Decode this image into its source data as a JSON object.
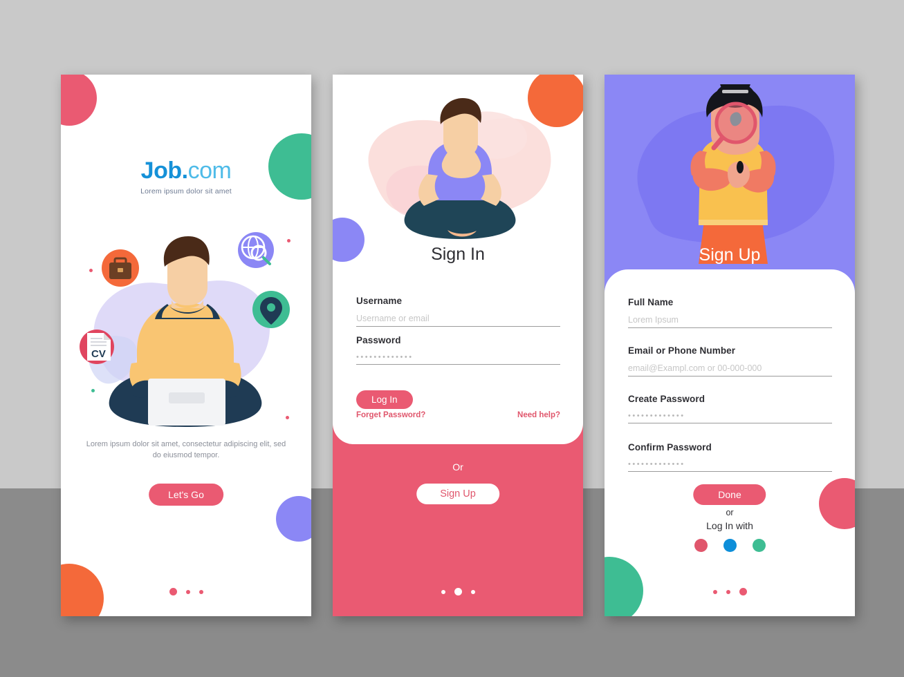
{
  "canvas": {
    "bg_top_color": "#c9c9c9",
    "bg_bottom_color": "#8b8b8b"
  },
  "palette": {
    "pink": "#ea5a72",
    "orange": "#f4693a",
    "green": "#3ebd93",
    "purple": "#8b87f5",
    "blue": "#0d8ed9",
    "logo_blue_dark": "#1591d8",
    "logo_blue_light": "#4ebbe8"
  },
  "screen1": {
    "name": "onboarding-splash",
    "logo": {
      "primary": "Job.",
      "secondary": "com",
      "tagline": "Lorem ipsum dolor sit amet"
    },
    "illustration": {
      "name": "man-with-laptop-illustration",
      "badges": [
        "briefcase-icon",
        "globe-search-icon",
        "location-pin-icon",
        "cv-document-icon"
      ],
      "cv_label": "CV"
    },
    "description": "Lorem ipsum dolor sit amet, consectetur adipiscing elit, sed do eiusmod tempor.",
    "cta_label": "Let's Go",
    "pagination": {
      "count": 3,
      "active": 1
    }
  },
  "screen2": {
    "name": "sign-in",
    "title": "Sign In",
    "illustration": {
      "name": "man-sitting-thinking-illustration"
    },
    "fields": [
      {
        "label": "Username",
        "placeholder": "Username or email",
        "value": "",
        "type": "text"
      },
      {
        "label": "Password",
        "placeholder": "",
        "value": "•••••••••••••",
        "type": "password"
      }
    ],
    "login_label": "Log In",
    "forgot_label": "Forget Password?",
    "help_label": "Need help?",
    "or_label": "Or",
    "signup_label": "Sign Up",
    "pagination": {
      "count": 3,
      "active": 2
    }
  },
  "screen3": {
    "name": "sign-up",
    "title": "Sign Up",
    "illustration": {
      "name": "woman-with-magnifying-glass-illustration"
    },
    "fields": [
      {
        "label": "Full Name",
        "placeholder": "Lorem Ipsum",
        "value": "",
        "type": "text"
      },
      {
        "label": "Email or Phone Number",
        "placeholder": "email@Exampl.com or 00-000-000",
        "value": "",
        "type": "text"
      },
      {
        "label": "Create Password",
        "placeholder": "",
        "value": "•••••••••••••",
        "type": "password"
      },
      {
        "label": "Confirm Password",
        "placeholder": "",
        "value": "•••••••••••••",
        "type": "password"
      }
    ],
    "done_label": "Done",
    "or_label": "or",
    "login_with_label": "Log In with",
    "social": [
      {
        "name": "social-dribbble",
        "color": "#e0566c"
      },
      {
        "name": "social-twitter",
        "color": "#0d8ed9"
      },
      {
        "name": "social-whatsapp",
        "color": "#3ebd93"
      }
    ],
    "pagination": {
      "count": 3,
      "active": 3
    }
  }
}
